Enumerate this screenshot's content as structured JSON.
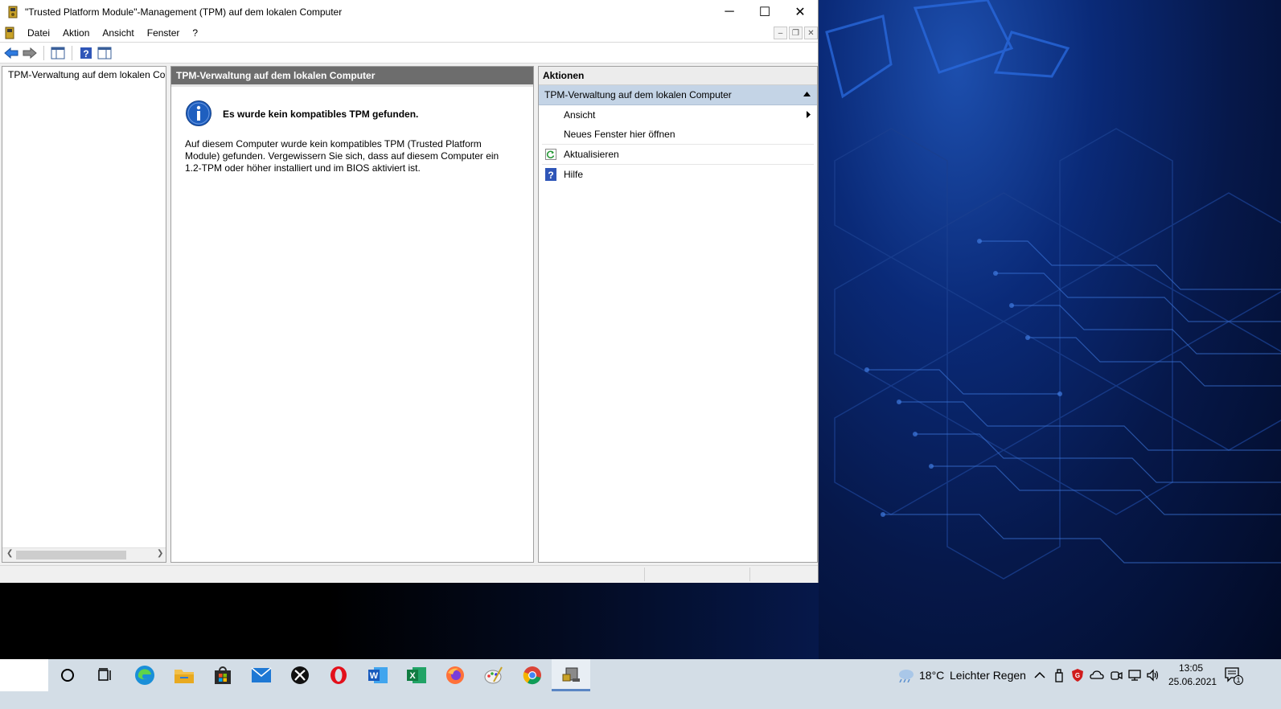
{
  "window": {
    "title": "\"Trusted Platform Module\"-Management (TPM) auf dem lokalen Computer",
    "controls": {
      "minimize": "─",
      "maximize": "☐",
      "close": "✕"
    }
  },
  "menubar": {
    "items": [
      "Datei",
      "Aktion",
      "Ansicht",
      "Fenster",
      "?"
    ]
  },
  "tree": {
    "root_label": "TPM-Verwaltung auf dem lokalen Computer"
  },
  "center": {
    "header": "TPM-Verwaltung auf dem lokalen Computer",
    "heading": "Es wurde kein kompatibles TPM gefunden.",
    "description": "Auf diesem Computer wurde kein kompatibles TPM (Trusted Platform Module) gefunden. Vergewissern Sie sich, dass auf diesem Computer ein 1.2-TPM oder höher installiert und im BIOS aktiviert ist."
  },
  "actions": {
    "header": "Aktionen",
    "section_title": "TPM-Verwaltung auf dem lokalen Computer",
    "items": [
      {
        "label": "Ansicht",
        "icon": "none",
        "submenu": true
      },
      {
        "label": "Neues Fenster hier öffnen",
        "icon": "none",
        "submenu": false
      },
      {
        "label": "Aktualisieren",
        "icon": "refresh-icon",
        "submenu": false
      },
      {
        "label": "Hilfe",
        "icon": "help-icon",
        "submenu": false
      }
    ]
  },
  "taskbar": {
    "apps": [
      "search-circle-icon",
      "task-view-icon",
      "edge-icon",
      "file-explorer-icon",
      "store-icon",
      "mail-icon",
      "xbox-icon",
      "opera-icon",
      "word-icon",
      "excel-icon",
      "firefox-icon",
      "paint-icon",
      "chrome-icon",
      "tpm-app-icon"
    ],
    "weather_temp": "18°C",
    "weather_text": "Leichter Regen",
    "time": "13:05",
    "date": "25.06.2021",
    "notification_count": "1"
  },
  "colors": {
    "pane_header": "#6d6d6d",
    "action_section": "#c4d4e6",
    "taskbar": "#d3dde6",
    "accent": "#1f5fbf"
  }
}
